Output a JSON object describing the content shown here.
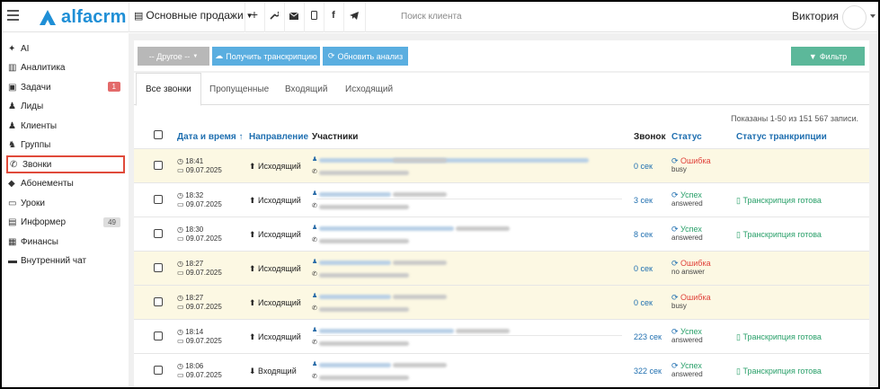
{
  "header": {
    "logo_text": "alfacrm",
    "business_selector": "Основные продажи",
    "search_placeholder": "Поиск клиента",
    "user_name": "Виктория"
  },
  "sidebar": {
    "items": [
      {
        "label": "AI",
        "icon": "sparkle-icon"
      },
      {
        "label": "Аналитика",
        "icon": "analytics-icon"
      },
      {
        "label": "Задачи",
        "icon": "tasks-icon",
        "badge": "1"
      },
      {
        "label": "Лиды",
        "icon": "leads-icon"
      },
      {
        "label": "Клиенты",
        "icon": "client-icon"
      },
      {
        "label": "Группы",
        "icon": "groups-icon"
      },
      {
        "label": "Звонки",
        "icon": "phone-icon",
        "active": true
      },
      {
        "label": "Абонементы",
        "icon": "tag-icon"
      },
      {
        "label": "Уроки",
        "icon": "lessons-icon"
      },
      {
        "label": "Информер",
        "icon": "informer-icon",
        "badge": "49"
      },
      {
        "label": "Финансы",
        "icon": "finance-icon"
      },
      {
        "label": "Внутренний чат",
        "icon": "chat-icon"
      }
    ]
  },
  "toolbar": {
    "other_label": "-- Другое --",
    "transcribe_label": "Получить транскрипцию",
    "refresh_label": "Обновить анализ",
    "filter_label": "Фильтр"
  },
  "tabs": [
    "Все звонки",
    "Пропущенные",
    "Входящий",
    "Исходящий"
  ],
  "count_text": "Показаны 1-50 из 151 567 записи.",
  "columns": {
    "datetime": "Дата и время ↑",
    "direction": "Направление",
    "participants": "Участники",
    "call": "Звонок",
    "status": "Статус",
    "transcription_status": "Статус транкрипции"
  },
  "rows": [
    {
      "time": "18:41",
      "date": "09.07.2025",
      "direction": "Исходящий",
      "duration": "0 сек",
      "status": "Ошибка",
      "status_sub": "busy",
      "transcript": "",
      "warn": true
    },
    {
      "time": "18:32",
      "date": "09.07.2025",
      "direction": "Исходящий",
      "duration": "3 сек",
      "status": "Успех",
      "status_sub": "answered",
      "transcript": "Транскрипция готова",
      "warn": false
    },
    {
      "time": "18:30",
      "date": "09.07.2025",
      "direction": "Исходящий",
      "duration": "8 сек",
      "status": "Успех",
      "status_sub": "answered",
      "transcript": "Транскрипция готова",
      "warn": false
    },
    {
      "time": "18:27",
      "date": "09.07.2025",
      "direction": "Исходящий",
      "duration": "0 сек",
      "status": "Ошибка",
      "status_sub": "no answer",
      "transcript": "",
      "warn": true
    },
    {
      "time": "18:27",
      "date": "09.07.2025",
      "direction": "Исходящий",
      "duration": "0 сек",
      "status": "Ошибка",
      "status_sub": "busy",
      "transcript": "",
      "warn": true
    },
    {
      "time": "18:14",
      "date": "09.07.2025",
      "direction": "Исходящий",
      "duration": "223 сек",
      "status": "Успех",
      "status_sub": "answered",
      "transcript": "Транскрипция готова",
      "warn": false
    },
    {
      "time": "18:06",
      "date": "09.07.2025",
      "direction": "Входящий",
      "duration": "322 сек",
      "status": "Успех",
      "status_sub": "answered",
      "transcript": "Транскрипция готова",
      "warn": false
    }
  ],
  "colors": {
    "brand": "#1f8fd6",
    "success": "#2aa06a",
    "error": "#e0413a",
    "warning_row": "#fcf8e3",
    "filter_button": "#5cb89a",
    "action_button": "#5aaee0",
    "other_button": "#b8b8b8"
  }
}
